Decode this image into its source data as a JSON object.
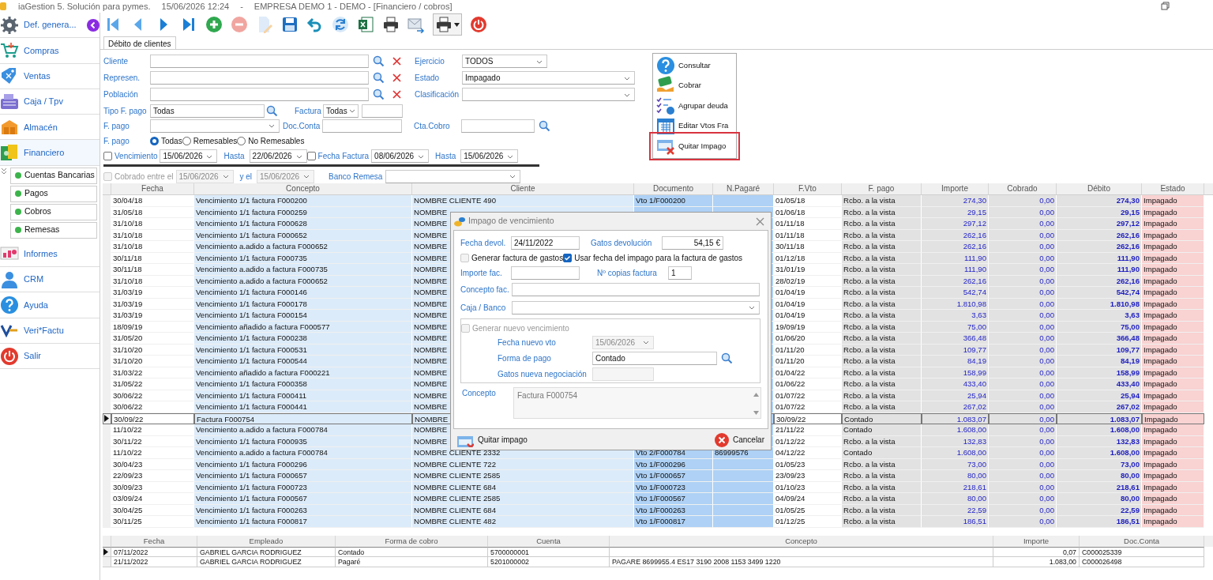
{
  "window": {
    "title": "iaGestion 5. Solución para pymes.",
    "datetime": "15/06/2026 12:24",
    "separator": "-",
    "company": "EMPRESA DEMO 1 - DEMO - [Financiero / cobros]"
  },
  "sidebar": {
    "items": [
      {
        "label": "Def. genera...",
        "kind": "gear"
      },
      {
        "label": "Compras",
        "kind": "cart"
      },
      {
        "label": "Ventas",
        "kind": "tag"
      },
      {
        "label": "Caja / Tpv",
        "kind": "register"
      },
      {
        "label": "Almacén",
        "kind": "boxes"
      },
      {
        "label": "Financiero",
        "kind": "money",
        "expanded": true,
        "children": [
          {
            "label": "Cuentas Bancarias"
          },
          {
            "label": "Pagos"
          },
          {
            "label": "Cobros"
          },
          {
            "label": "Remesas"
          }
        ]
      },
      {
        "label": "Informes",
        "kind": "chart"
      },
      {
        "label": "CRM",
        "kind": "person"
      },
      {
        "label": "Ayuda",
        "kind": "help"
      },
      {
        "label": "Veri*Factu",
        "kind": "logo"
      },
      {
        "label": "Salir",
        "kind": "power"
      }
    ]
  },
  "toolbar": [
    {
      "kind": "first",
      "disabled": false
    },
    {
      "kind": "prev",
      "disabled": false
    },
    {
      "kind": "next",
      "disabled": false
    },
    {
      "kind": "last",
      "disabled": false
    },
    {
      "kind": "add",
      "disabled": false
    },
    {
      "kind": "delete",
      "disabled": true
    },
    {
      "kind": "edit",
      "disabled": true
    },
    {
      "kind": "save",
      "disabled": false
    },
    {
      "kind": "undo",
      "disabled": false
    },
    {
      "kind": "refresh",
      "disabled": false
    },
    {
      "kind": "excel",
      "disabled": false
    },
    {
      "kind": "print",
      "disabled": false
    },
    {
      "kind": "mail",
      "disabled": false
    },
    {
      "kind": "print_menu",
      "disabled": false
    },
    {
      "kind": "power",
      "disabled": false
    }
  ],
  "tabs": [
    {
      "label": "Débito de clientes",
      "selected": true
    }
  ],
  "filters": {
    "lookups": [
      {
        "label": "Cliente"
      },
      {
        "label": "Represen."
      },
      {
        "label": "Población"
      }
    ],
    "ejercicio": {
      "label": "Ejercicio",
      "value": "TODOS"
    },
    "estado": {
      "label": "Estado",
      "value": "Impagado"
    },
    "clasificacion": {
      "label": "Clasificación"
    },
    "tipo_f_pago": {
      "label": "Tipo F. pago",
      "value": "Todas"
    },
    "factura": {
      "label": "Factura",
      "value": "Todas"
    },
    "f_pago": {
      "label": "F. pago"
    },
    "doc_conta": {
      "label": "Doc.Conta"
    },
    "cta_cobro": {
      "label": "Cta.Cobro"
    },
    "f_pago_radios": {
      "label": "F. pago",
      "options": [
        {
          "label": "Todas",
          "selected": true
        },
        {
          "label": "Remesables",
          "selected": false
        },
        {
          "label": "No Remesables",
          "selected": false
        }
      ]
    },
    "vencimiento": {
      "label": "Vencimiento",
      "checked": false,
      "disabled": false,
      "from": "15/06/2026",
      "to_label": "Hasta",
      "to": "22/06/2026"
    },
    "fecha_factura": {
      "label": "Fecha Factura",
      "checked": false,
      "disabled": false,
      "from": "08/06/2026",
      "to_label": "Hasta",
      "to": "15/06/2026"
    },
    "cobrado": {
      "label": "Cobrado entre el",
      "checked": false,
      "disabled": true,
      "from": "15/06/2026",
      "to_label": "y el",
      "to": "15/06/2026"
    },
    "banco_remesa": {
      "label": "Banco Remesa"
    }
  },
  "context_menu": {
    "items": [
      {
        "label": "Consultar",
        "kind": "help",
        "highlighted": false
      },
      {
        "label": "Cobrar",
        "kind": "cash",
        "highlighted": false
      },
      {
        "label": "Agrupar deuda",
        "kind": "group",
        "highlighted": false
      },
      {
        "label": "Editar Vtos Fra",
        "kind": "calendar",
        "highlighted": false
      },
      {
        "label": "Quitar Impago",
        "kind": "unpay",
        "highlighted": true
      }
    ]
  },
  "table": {
    "columns": [
      "Fecha",
      "Concepto",
      "Cliente",
      "Documento",
      "N.Pagaré",
      "F.Vto",
      "F. pago",
      "Importe",
      "Cobrado",
      "Débito",
      "Estado"
    ],
    "rows": [
      {
        "fecha": "30/04/18",
        "concepto": "Vencimiento 1/1 factura F000200",
        "cliente": "NOMBRE CLIENTE 490",
        "documento": "Vto 1/F000200",
        "f_vto": "01/05/18",
        "f_pago": "Rcbo. a la vista",
        "importe": "274,30",
        "cobrado": "0,00",
        "debito": "274,30",
        "estado": "Impagado",
        "selected": false
      },
      {
        "fecha": "31/05/18",
        "concepto": "Vencimiento 1/1 factura F000259",
        "cliente": "NOMBRE",
        "f_vto": "01/06/18",
        "f_pago": "Rcbo. a la vista",
        "importe": "29,15",
        "cobrado": "0,00",
        "debito": "29,15",
        "estado": "Impagado",
        "selected": false
      },
      {
        "fecha": "31/10/18",
        "concepto": "Vencimiento 1/1 factura F000628",
        "cliente": "NOMBRE",
        "f_vto": "01/11/18",
        "f_pago": "Rcbo. a la vista",
        "importe": "297,12",
        "cobrado": "0,00",
        "debito": "297,12",
        "estado": "Impagado",
        "selected": false
      },
      {
        "fecha": "31/10/18",
        "concepto": "Vencimiento 1/1 factura F000652",
        "cliente": "NOMBRE",
        "f_vto": "01/11/18",
        "f_pago": "Rcbo. a la vista",
        "importe": "262,16",
        "cobrado": "0,00",
        "debito": "262,16",
        "estado": "Impagado",
        "selected": false
      },
      {
        "fecha": "31/10/18",
        "concepto": "Vencimiento a.adido a factura F000652",
        "cliente": "NOMBRE",
        "f_vto": "30/11/18",
        "f_pago": "Rcbo. a la vista",
        "importe": "262,16",
        "cobrado": "0,00",
        "debito": "262,16",
        "estado": "Impagado",
        "selected": false
      },
      {
        "fecha": "30/11/18",
        "concepto": "Vencimiento 1/1 factura F000735",
        "cliente": "NOMBRE",
        "f_vto": "01/12/18",
        "f_pago": "Rcbo. a la vista",
        "importe": "111,90",
        "cobrado": "0,00",
        "debito": "111,90",
        "estado": "Impagado",
        "selected": false
      },
      {
        "fecha": "30/11/18",
        "concepto": "Vencimiento a.adido a factura F000735",
        "cliente": "NOMBRE",
        "f_vto": "31/01/19",
        "f_pago": "Rcbo. a la vista",
        "importe": "111,90",
        "cobrado": "0,00",
        "debito": "111,90",
        "estado": "Impagado",
        "selected": false
      },
      {
        "fecha": "31/10/18",
        "concepto": "Vencimiento a.adido a factura F000652",
        "cliente": "NOMBRE",
        "f_vto": "28/02/19",
        "f_pago": "Rcbo. a la vista",
        "importe": "262,16",
        "cobrado": "0,00",
        "debito": "262,16",
        "estado": "Impagado",
        "selected": false
      },
      {
        "fecha": "31/03/19",
        "concepto": "Vencimiento 1/1 factura F000146",
        "cliente": "NOMBRE",
        "f_vto": "01/04/19",
        "f_pago": "Rcbo. a la vista",
        "importe": "542,74",
        "cobrado": "0,00",
        "debito": "542,74",
        "estado": "Impagado",
        "selected": false
      },
      {
        "fecha": "31/03/19",
        "concepto": "Vencimiento 1/1 factura F000178",
        "cliente": "NOMBRE",
        "f_vto": "01/04/19",
        "f_pago": "Rcbo. a la vista",
        "importe": "1.810,98",
        "cobrado": "0,00",
        "debito": "1.810,98",
        "estado": "Impagado",
        "selected": false
      },
      {
        "fecha": "31/03/19",
        "concepto": "Vencimiento 1/1 factura F000154",
        "cliente": "NOMBRE",
        "f_vto": "01/04/19",
        "f_pago": "Rcbo. a la vista",
        "importe": "3,63",
        "cobrado": "0,00",
        "debito": "3,63",
        "estado": "Impagado",
        "selected": false
      },
      {
        "fecha": "18/09/19",
        "concepto": "Vencimiento añadido a factura F000577",
        "cliente": "NOMBRE",
        "f_vto": "19/09/19",
        "f_pago": "Rcbo. a la vista",
        "importe": "75,00",
        "cobrado": "0,00",
        "debito": "75,00",
        "estado": "Impagado",
        "selected": false
      },
      {
        "fecha": "31/05/20",
        "concepto": "Vencimiento 1/1 factura F000238",
        "cliente": "NOMBRE",
        "f_vto": "01/06/20",
        "f_pago": "Rcbo. a la vista",
        "importe": "366,48",
        "cobrado": "0,00",
        "debito": "366,48",
        "estado": "Impagado",
        "selected": false
      },
      {
        "fecha": "31/10/20",
        "concepto": "Vencimiento 1/1 factura F000531",
        "cliente": "NOMBRE",
        "f_vto": "01/11/20",
        "f_pago": "Rcbo. a la vista",
        "importe": "109,77",
        "cobrado": "0,00",
        "debito": "109,77",
        "estado": "Impagado",
        "selected": false
      },
      {
        "fecha": "31/10/20",
        "concepto": "Vencimiento 1/1 factura F000544",
        "cliente": "NOMBRE",
        "f_vto": "01/11/20",
        "f_pago": "Rcbo. a la vista",
        "importe": "84,19",
        "cobrado": "0,00",
        "debito": "84,19",
        "estado": "Impagado",
        "selected": false
      },
      {
        "fecha": "31/03/22",
        "concepto": "Vencimiento añadido a factura F000221",
        "cliente": "NOMBRE",
        "f_vto": "01/04/22",
        "f_pago": "Rcbo. a la vista",
        "importe": "158,99",
        "cobrado": "0,00",
        "debito": "158,99",
        "estado": "Impagado",
        "selected": false
      },
      {
        "fecha": "31/05/22",
        "concepto": "Vencimiento 1/1 factura F000358",
        "cliente": "NOMBRE",
        "f_vto": "01/06/22",
        "f_pago": "Rcbo. a la vista",
        "importe": "433,40",
        "cobrado": "0,00",
        "debito": "433,40",
        "estado": "Impagado",
        "selected": false
      },
      {
        "fecha": "30/06/22",
        "concepto": "Vencimiento 1/1 factura F000411",
        "cliente": "NOMBRE",
        "f_vto": "01/07/22",
        "f_pago": "Rcbo. a la vista",
        "importe": "25,94",
        "cobrado": "0,00",
        "debito": "25,94",
        "estado": "Impagado",
        "selected": false
      },
      {
        "fecha": "30/06/22",
        "concepto": "Vencimiento 1/1 factura F000441",
        "cliente": "NOMBRE",
        "f_vto": "01/07/22",
        "f_pago": "Rcbo. a la vista",
        "importe": "267,02",
        "cobrado": "0,00",
        "debito": "267,02",
        "estado": "Impagado",
        "selected": false
      },
      {
        "fecha": "30/09/22",
        "concepto": "Factura F000754",
        "cliente": "NOMBRE",
        "f_vto": "30/09/22",
        "f_pago": "Contado",
        "importe": "1.083,07",
        "cobrado": "0,00",
        "debito": "1.083,07",
        "estado": "Impagado",
        "selected": true
      },
      {
        "fecha": "11/10/22",
        "concepto": "Vencimiento a.adido a factura F000784",
        "cliente": "NOMBRE",
        "f_vto": "21/11/22",
        "f_pago": "Contado",
        "importe": "1.608,00",
        "cobrado": "0,00",
        "debito": "1.608,00",
        "estado": "Impagado",
        "selected": false
      },
      {
        "fecha": "30/11/22",
        "concepto": "Vencimiento 1/1 factura F000935",
        "cliente": "NOMBRE",
        "f_vto": "01/12/22",
        "f_pago": "Rcbo. a la vista",
        "importe": "132,83",
        "cobrado": "0,00",
        "debito": "132,83",
        "estado": "Impagado",
        "selected": false
      },
      {
        "fecha": "11/10/22",
        "concepto": "Vencimiento a.adido a factura F000784",
        "cliente": "NOMBRE CLIENTE 2332",
        "documento": "Vto 2/F000784",
        "n_pagare": "86999576",
        "f_vto": "04/12/22",
        "f_pago": "Contado",
        "importe": "1.608,00",
        "cobrado": "0,00",
        "debito": "1.608,00",
        "estado": "Impagado",
        "selected": false
      },
      {
        "fecha": "30/04/23",
        "concepto": "Vencimiento 1/1 factura F000296",
        "cliente": "NOMBRE CLIENTE 722",
        "documento": "Vto 1/F000296",
        "f_vto": "01/05/23",
        "f_pago": "Rcbo. a la vista",
        "importe": "73,00",
        "cobrado": "0,00",
        "debito": "73,00",
        "estado": "Impagado",
        "selected": false
      },
      {
        "fecha": "22/09/23",
        "concepto": "Vencimiento 1/1 factura F000657",
        "cliente": "NOMBRE CLIENTE 2585",
        "documento": "Vto 1/F000657",
        "f_vto": "23/09/23",
        "f_pago": "Rcbo. a la vista",
        "importe": "80,00",
        "cobrado": "0,00",
        "debito": "80,00",
        "estado": "Impagado",
        "selected": false
      },
      {
        "fecha": "30/09/23",
        "concepto": "Vencimiento 1/1 factura F000723",
        "cliente": "NOMBRE CLIENTE 684",
        "documento": "Vto 1/F000723",
        "f_vto": "01/10/23",
        "f_pago": "Rcbo. a la vista",
        "importe": "218,61",
        "cobrado": "0,00",
        "debito": "218,61",
        "estado": "Impagado",
        "selected": false
      },
      {
        "fecha": "03/09/24",
        "concepto": "Vencimiento 1/1 factura F000567",
        "cliente": "NOMBRE CLIENTE 2585",
        "documento": "Vto 1/F000567",
        "f_vto": "04/09/24",
        "f_pago": "Rcbo. a la vista",
        "importe": "80,00",
        "cobrado": "0,00",
        "debito": "80,00",
        "estado": "Impagado",
        "selected": false
      },
      {
        "fecha": "30/04/25",
        "concepto": "Vencimiento 1/1 factura F000263",
        "cliente": "NOMBRE CLIENTE 684",
        "documento": "Vto 1/F000263",
        "f_vto": "01/05/25",
        "f_pago": "Rcbo. a la vista",
        "importe": "22,59",
        "cobrado": "0,00",
        "debito": "22,59",
        "estado": "Impagado",
        "selected": false
      },
      {
        "fecha": "30/11/25",
        "concepto": "Vencimiento 1/1 factura F000817",
        "cliente": "NOMBRE CLIENTE 482",
        "documento": "Vto 1/F000817",
        "f_vto": "01/12/25",
        "f_pago": "Rcbo. a la vista",
        "importe": "186,51",
        "cobrado": "0,00",
        "debito": "186,51",
        "estado": "Impagado",
        "selected": false
      }
    ]
  },
  "dialog": {
    "title": "Impago de vencimiento",
    "fecha_devol": {
      "label": "Fecha devol.",
      "value": "24/11/2022"
    },
    "gastos": {
      "label": "Gatos devolución",
      "value": "54,15 €"
    },
    "checks": [
      {
        "label": "Generar factura de gastos",
        "checked": false,
        "disabled": true
      },
      {
        "label": "Usar fecha del impago para la factura de gastos",
        "checked": true,
        "disabled": false
      }
    ],
    "importe_fac": {
      "label": "Importe fac."
    },
    "copias": {
      "label": "Nº copias factura",
      "value": "1"
    },
    "concepto_fac": {
      "label": "Concepto fac."
    },
    "caja_banco": {
      "label": "Caja / Banco"
    },
    "nuevo_vto": {
      "label": "Generar nuevo vencimiento",
      "checked": false,
      "disabled": true,
      "fecha": {
        "label": "Fecha nuevo vto",
        "value": "15/06/2026"
      },
      "forma_pago": {
        "label": "Forma de pago",
        "value": "Contado"
      },
      "gastos": {
        "label": "Gatos nueva negociación"
      }
    },
    "concepto": {
      "label": "Concepto",
      "value": "Factura F000754"
    },
    "buttons": [
      {
        "label": "Quitar impago",
        "kind": "confirm"
      },
      {
        "label": "Cancelar",
        "kind": "cancel"
      }
    ]
  },
  "bottom_table": {
    "columns": [
      "Fecha",
      "Empleado",
      "Forma de cobro",
      "Cuenta",
      "Concepto",
      "Importe",
      "Doc.Conta"
    ],
    "rows": [
      {
        "fecha": "07/11/2022",
        "empleado": "GABRIEL GARCIA RODRIGUEZ",
        "forma": "Contado",
        "cuenta": "5700000001",
        "importe": "0,07",
        "doc": "C000025339",
        "selected": true
      },
      {
        "fecha": "21/11/2022",
        "empleado": "GABRIEL GARCIA RODRIGUEZ",
        "forma": "Pagaré",
        "cuenta": "5201000002",
        "concepto": "PAGARE 8699955.4 ES17 3190 2008 1153 3499 1220",
        "importe": "1.083,00",
        "doc": "C000026498",
        "selected": false
      }
    ]
  }
}
